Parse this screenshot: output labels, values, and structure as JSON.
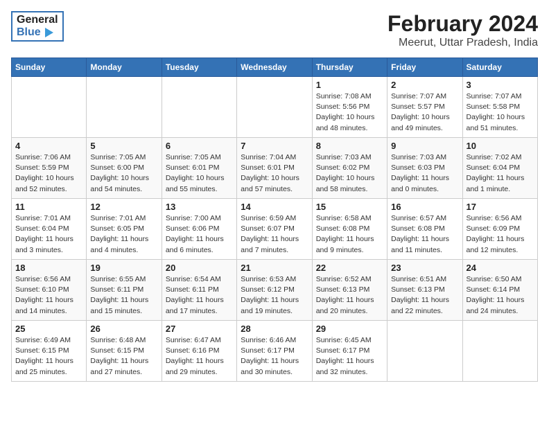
{
  "header": {
    "logo_general": "General",
    "logo_blue": "Blue",
    "title": "February 2024",
    "subtitle": "Meerut, Uttar Pradesh, India"
  },
  "weekdays": [
    "Sunday",
    "Monday",
    "Tuesday",
    "Wednesday",
    "Thursday",
    "Friday",
    "Saturday"
  ],
  "weeks": [
    [
      {
        "day": "",
        "sunrise": "",
        "sunset": "",
        "daylight": ""
      },
      {
        "day": "",
        "sunrise": "",
        "sunset": "",
        "daylight": ""
      },
      {
        "day": "",
        "sunrise": "",
        "sunset": "",
        "daylight": ""
      },
      {
        "day": "",
        "sunrise": "",
        "sunset": "",
        "daylight": ""
      },
      {
        "day": "1",
        "sunrise": "Sunrise: 7:08 AM",
        "sunset": "Sunset: 5:56 PM",
        "daylight": "Daylight: 10 hours and 48 minutes."
      },
      {
        "day": "2",
        "sunrise": "Sunrise: 7:07 AM",
        "sunset": "Sunset: 5:57 PM",
        "daylight": "Daylight: 10 hours and 49 minutes."
      },
      {
        "day": "3",
        "sunrise": "Sunrise: 7:07 AM",
        "sunset": "Sunset: 5:58 PM",
        "daylight": "Daylight: 10 hours and 51 minutes."
      }
    ],
    [
      {
        "day": "4",
        "sunrise": "Sunrise: 7:06 AM",
        "sunset": "Sunset: 5:59 PM",
        "daylight": "Daylight: 10 hours and 52 minutes."
      },
      {
        "day": "5",
        "sunrise": "Sunrise: 7:05 AM",
        "sunset": "Sunset: 6:00 PM",
        "daylight": "Daylight: 10 hours and 54 minutes."
      },
      {
        "day": "6",
        "sunrise": "Sunrise: 7:05 AM",
        "sunset": "Sunset: 6:01 PM",
        "daylight": "Daylight: 10 hours and 55 minutes."
      },
      {
        "day": "7",
        "sunrise": "Sunrise: 7:04 AM",
        "sunset": "Sunset: 6:01 PM",
        "daylight": "Daylight: 10 hours and 57 minutes."
      },
      {
        "day": "8",
        "sunrise": "Sunrise: 7:03 AM",
        "sunset": "Sunset: 6:02 PM",
        "daylight": "Daylight: 10 hours and 58 minutes."
      },
      {
        "day": "9",
        "sunrise": "Sunrise: 7:03 AM",
        "sunset": "Sunset: 6:03 PM",
        "daylight": "Daylight: 11 hours and 0 minutes."
      },
      {
        "day": "10",
        "sunrise": "Sunrise: 7:02 AM",
        "sunset": "Sunset: 6:04 PM",
        "daylight": "Daylight: 11 hours and 1 minute."
      }
    ],
    [
      {
        "day": "11",
        "sunrise": "Sunrise: 7:01 AM",
        "sunset": "Sunset: 6:04 PM",
        "daylight": "Daylight: 11 hours and 3 minutes."
      },
      {
        "day": "12",
        "sunrise": "Sunrise: 7:01 AM",
        "sunset": "Sunset: 6:05 PM",
        "daylight": "Daylight: 11 hours and 4 minutes."
      },
      {
        "day": "13",
        "sunrise": "Sunrise: 7:00 AM",
        "sunset": "Sunset: 6:06 PM",
        "daylight": "Daylight: 11 hours and 6 minutes."
      },
      {
        "day": "14",
        "sunrise": "Sunrise: 6:59 AM",
        "sunset": "Sunset: 6:07 PM",
        "daylight": "Daylight: 11 hours and 7 minutes."
      },
      {
        "day": "15",
        "sunrise": "Sunrise: 6:58 AM",
        "sunset": "Sunset: 6:08 PM",
        "daylight": "Daylight: 11 hours and 9 minutes."
      },
      {
        "day": "16",
        "sunrise": "Sunrise: 6:57 AM",
        "sunset": "Sunset: 6:08 PM",
        "daylight": "Daylight: 11 hours and 11 minutes."
      },
      {
        "day": "17",
        "sunrise": "Sunrise: 6:56 AM",
        "sunset": "Sunset: 6:09 PM",
        "daylight": "Daylight: 11 hours and 12 minutes."
      }
    ],
    [
      {
        "day": "18",
        "sunrise": "Sunrise: 6:56 AM",
        "sunset": "Sunset: 6:10 PM",
        "daylight": "Daylight: 11 hours and 14 minutes."
      },
      {
        "day": "19",
        "sunrise": "Sunrise: 6:55 AM",
        "sunset": "Sunset: 6:11 PM",
        "daylight": "Daylight: 11 hours and 15 minutes."
      },
      {
        "day": "20",
        "sunrise": "Sunrise: 6:54 AM",
        "sunset": "Sunset: 6:11 PM",
        "daylight": "Daylight: 11 hours and 17 minutes."
      },
      {
        "day": "21",
        "sunrise": "Sunrise: 6:53 AM",
        "sunset": "Sunset: 6:12 PM",
        "daylight": "Daylight: 11 hours and 19 minutes."
      },
      {
        "day": "22",
        "sunrise": "Sunrise: 6:52 AM",
        "sunset": "Sunset: 6:13 PM",
        "daylight": "Daylight: 11 hours and 20 minutes."
      },
      {
        "day": "23",
        "sunrise": "Sunrise: 6:51 AM",
        "sunset": "Sunset: 6:13 PM",
        "daylight": "Daylight: 11 hours and 22 minutes."
      },
      {
        "day": "24",
        "sunrise": "Sunrise: 6:50 AM",
        "sunset": "Sunset: 6:14 PM",
        "daylight": "Daylight: 11 hours and 24 minutes."
      }
    ],
    [
      {
        "day": "25",
        "sunrise": "Sunrise: 6:49 AM",
        "sunset": "Sunset: 6:15 PM",
        "daylight": "Daylight: 11 hours and 25 minutes."
      },
      {
        "day": "26",
        "sunrise": "Sunrise: 6:48 AM",
        "sunset": "Sunset: 6:15 PM",
        "daylight": "Daylight: 11 hours and 27 minutes."
      },
      {
        "day": "27",
        "sunrise": "Sunrise: 6:47 AM",
        "sunset": "Sunset: 6:16 PM",
        "daylight": "Daylight: 11 hours and 29 minutes."
      },
      {
        "day": "28",
        "sunrise": "Sunrise: 6:46 AM",
        "sunset": "Sunset: 6:17 PM",
        "daylight": "Daylight: 11 hours and 30 minutes."
      },
      {
        "day": "29",
        "sunrise": "Sunrise: 6:45 AM",
        "sunset": "Sunset: 6:17 PM",
        "daylight": "Daylight: 11 hours and 32 minutes."
      },
      {
        "day": "",
        "sunrise": "",
        "sunset": "",
        "daylight": ""
      },
      {
        "day": "",
        "sunrise": "",
        "sunset": "",
        "daylight": ""
      }
    ]
  ]
}
